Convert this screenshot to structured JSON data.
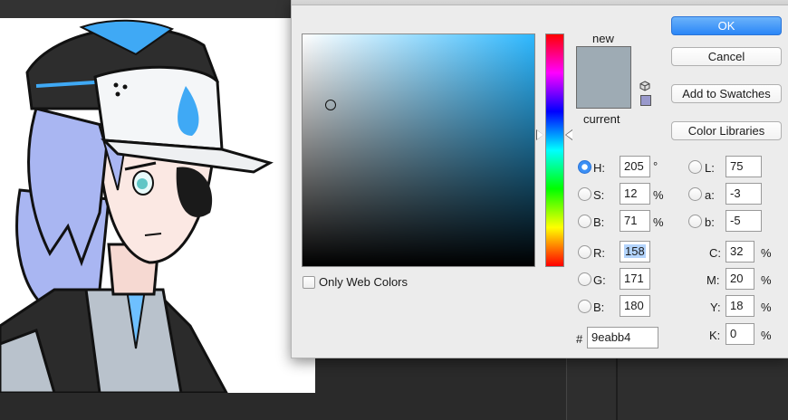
{
  "dialog": {
    "buttons": {
      "ok": "OK",
      "cancel": "Cancel",
      "add_to_swatches": "Add to Swatches",
      "color_libraries": "Color Libraries"
    },
    "preview": {
      "new_label": "new",
      "current_label": "current",
      "new_color": "#9eabb4",
      "current_color": "#9eabb4"
    },
    "only_web_colors": {
      "label": "Only Web Colors",
      "checked": false
    },
    "hsb": {
      "h": {
        "label": "H:",
        "value": "205",
        "unit": "°",
        "selected": true
      },
      "s": {
        "label": "S:",
        "value": "12",
        "unit": "%"
      },
      "b": {
        "label": "B:",
        "value": "71",
        "unit": "%"
      }
    },
    "rgb": {
      "r": {
        "label": "R:",
        "value": "158"
      },
      "g": {
        "label": "G:",
        "value": "171"
      },
      "b": {
        "label": "B:",
        "value": "180"
      }
    },
    "lab": {
      "l": {
        "label": "L:",
        "value": "75"
      },
      "a": {
        "label": "a:",
        "value": "-3"
      },
      "b": {
        "label": "b:",
        "value": "-5"
      }
    },
    "cmyk": {
      "c": {
        "label": "C:",
        "value": "32",
        "unit": "%"
      },
      "m": {
        "label": "M:",
        "value": "20",
        "unit": "%"
      },
      "y": {
        "label": "Y:",
        "value": "18",
        "unit": "%"
      },
      "k": {
        "label": "K:",
        "value": "0",
        "unit": "%"
      }
    },
    "hex": {
      "label": "#",
      "value": "9eabb4"
    }
  },
  "colors": {
    "accent": "#2a86f7",
    "hue_base": "#2eb8ff"
  },
  "icons": {
    "cube": "cube-icon",
    "websafe": "websafe-cube-icon"
  }
}
